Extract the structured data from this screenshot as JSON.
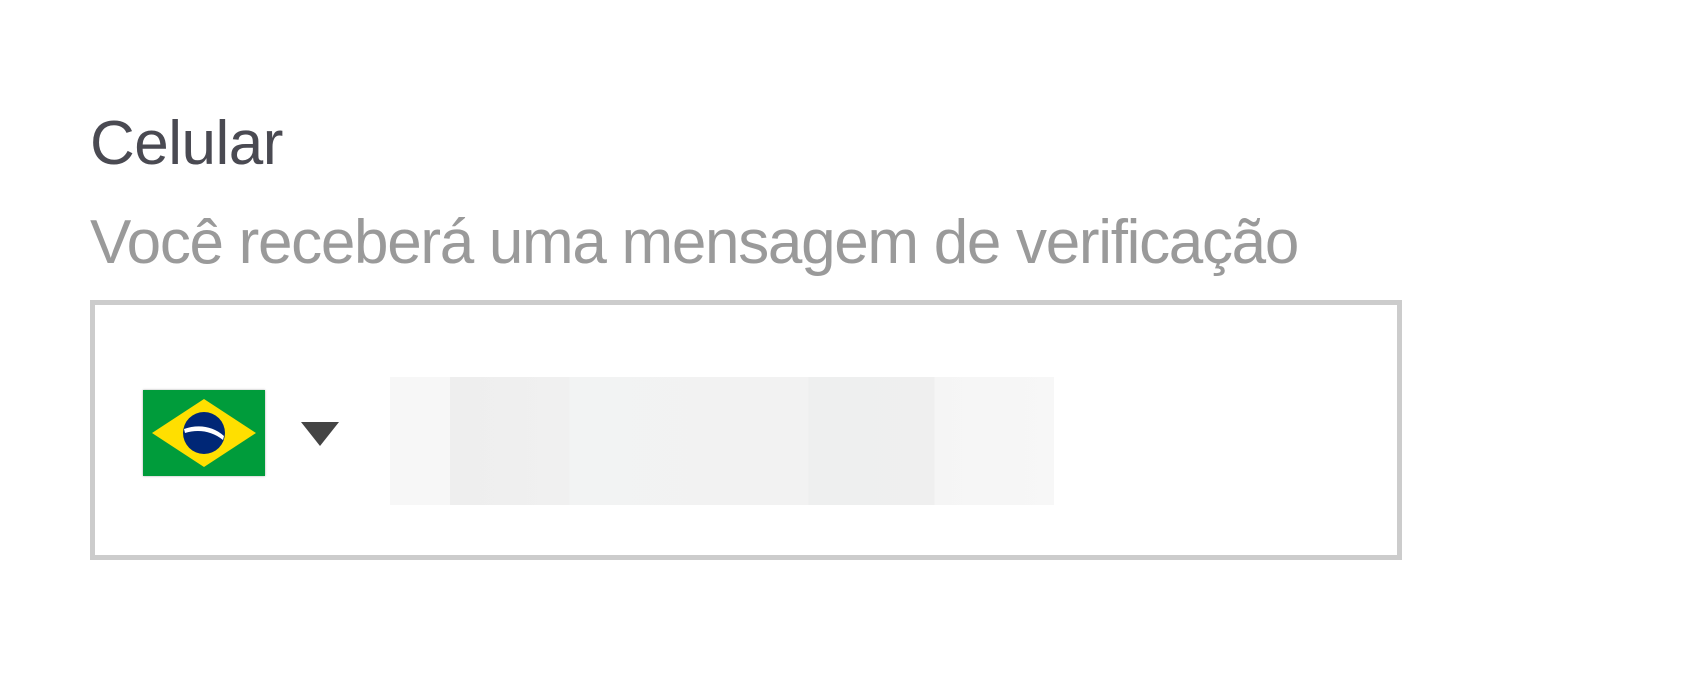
{
  "phone_field": {
    "label": "Celular",
    "hint": "Você receberá uma mensagem de verificação",
    "country": {
      "flag_icon": "brazil-flag-icon",
      "dropdown_icon": "caret-down-icon"
    },
    "number_value": "",
    "number_placeholder": ""
  },
  "colors": {
    "label": "#4a4a52",
    "hint": "#9a9a9a",
    "border": "#cccccc",
    "caret": "#444444"
  }
}
